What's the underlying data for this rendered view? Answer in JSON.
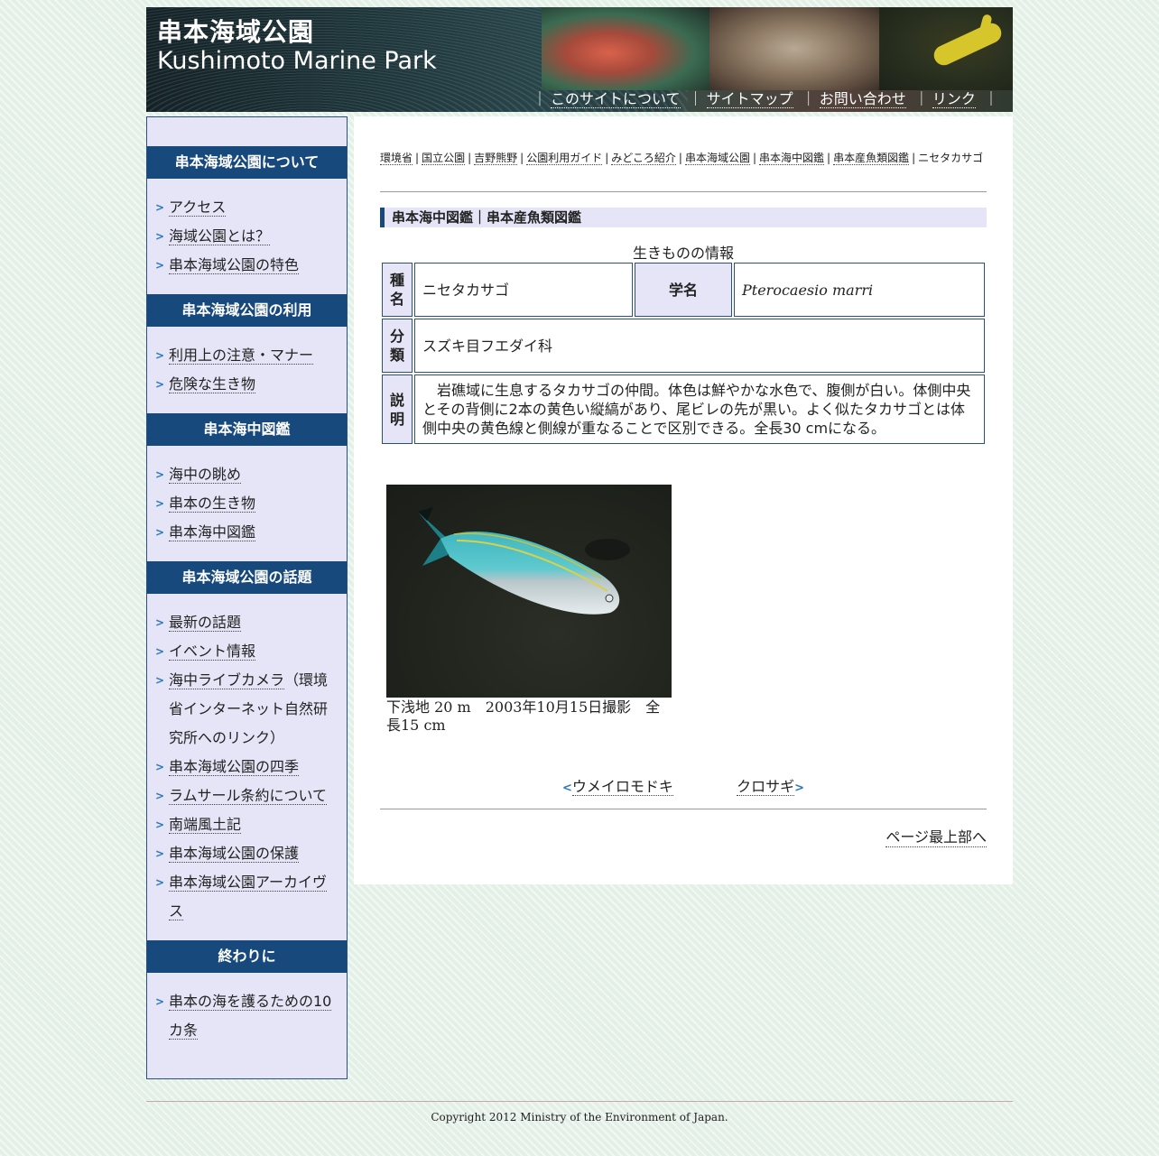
{
  "header": {
    "title_ja": "串本海域公園",
    "title_en": "Kushimoto Marine Park",
    "nav": [
      {
        "label": "このサイトについて"
      },
      {
        "label": "サイトマップ"
      },
      {
        "label": "お問い合わせ"
      },
      {
        "label": "リンク"
      }
    ],
    "separator": "｜"
  },
  "sidebar": {
    "sections": [
      {
        "heading": "串本海域公園について",
        "items": [
          "アクセス",
          "海域公園とは？",
          "串本海域公園の特色"
        ]
      },
      {
        "heading": "串本海域公園の利用",
        "items": [
          "利用上の注意・マナー",
          "危険な生き物"
        ]
      },
      {
        "heading": "串本海中図鑑",
        "items": [
          "海中の眺め",
          "串本の生き物",
          "串本海中図鑑"
        ]
      },
      {
        "heading": "串本海域公園の話題",
        "items": [
          "最新の話題",
          "イベント情報",
          "海中ライブカメラ",
          "串本海域公園の四季",
          "ラムサール条約について",
          "南端風土記",
          "串本海域公園の保護",
          "串本海域公園アーカイヴス"
        ],
        "live_camera_note": "（環境省インターネット自然研究所へのリンク）"
      },
      {
        "heading": "終わりに",
        "items": [
          "串本の海を護るための10カ条"
        ]
      }
    ],
    "bullet": ">"
  },
  "breadcrumb": {
    "links": [
      "環境省",
      "国立公園",
      "吉野熊野",
      "公園利用ガイド",
      "みどころ紹介",
      "串本海域公園",
      "串本海中図鑑",
      "串本産魚類図鑑"
    ],
    "current": "ニセタカサゴ",
    "separator": "|"
  },
  "main": {
    "section_title": "串本海中図鑑｜串本産魚類図鑑",
    "table_caption": "生きものの情報",
    "species_label": "種名",
    "species_value": "ニセタカサゴ",
    "scientific_label": "学名",
    "scientific_value": "Pterocaesio marri",
    "classification_label": "分類",
    "classification_value": "スズキ目フエダイ科",
    "description_label": "説明",
    "description_value": "　岩礁域に生息するタカサゴの仲間。体色は鮮やかな水色で、腹側が白い。体側中央とその背側に2本の黄色い縦縞があり、尾ビレの先が黒い。よく似たタカサゴとは体側中央の黄色線と側線が重なることで区別できる。全長30 cmになる。",
    "photo_caption": "下浅地 20 m　2003年10月15日撮影　全長15 cm",
    "prev_label": "ウメイロモドキ",
    "next_label": "クロサギ",
    "prev_chev": "<",
    "next_chev": ">",
    "to_top": "ページ最上部へ"
  },
  "footer": {
    "copyright": "Copyright 2012 Ministry of the Environment of Japan."
  },
  "colors": {
    "nav_blue": "#17497c",
    "side_bg": "#e5e5f7",
    "page_bg": "#e3f0e6",
    "accent_arrow": "#2a7ab6"
  },
  "icons": {
    "bullet": "chevron-right-icon",
    "prev": "chevron-left-icon",
    "next": "chevron-right-icon"
  }
}
